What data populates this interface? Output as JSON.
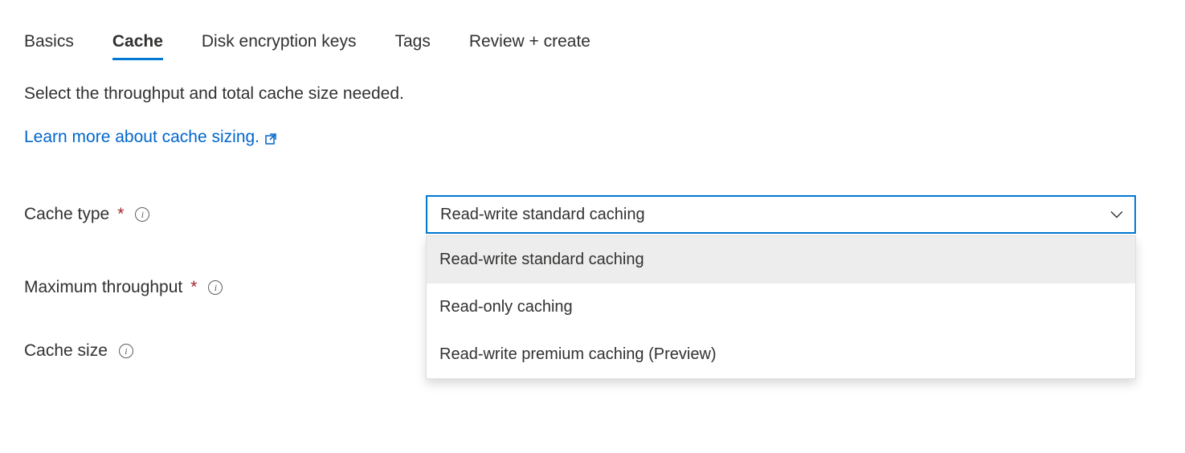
{
  "tabs": {
    "basics": "Basics",
    "cache": "Cache",
    "disk_encryption": "Disk encryption keys",
    "tags": "Tags",
    "review": "Review + create"
  },
  "description": "Select the throughput and total cache size needed.",
  "learn_link": "Learn more about cache sizing.",
  "form": {
    "cache_type": {
      "label": "Cache type",
      "selected": "Read-write standard caching",
      "options": [
        "Read-write standard caching",
        "Read-only caching",
        "Read-write premium caching (Preview)"
      ]
    },
    "max_throughput": {
      "label": "Maximum throughput"
    },
    "cache_size": {
      "label": "Cache size"
    }
  }
}
